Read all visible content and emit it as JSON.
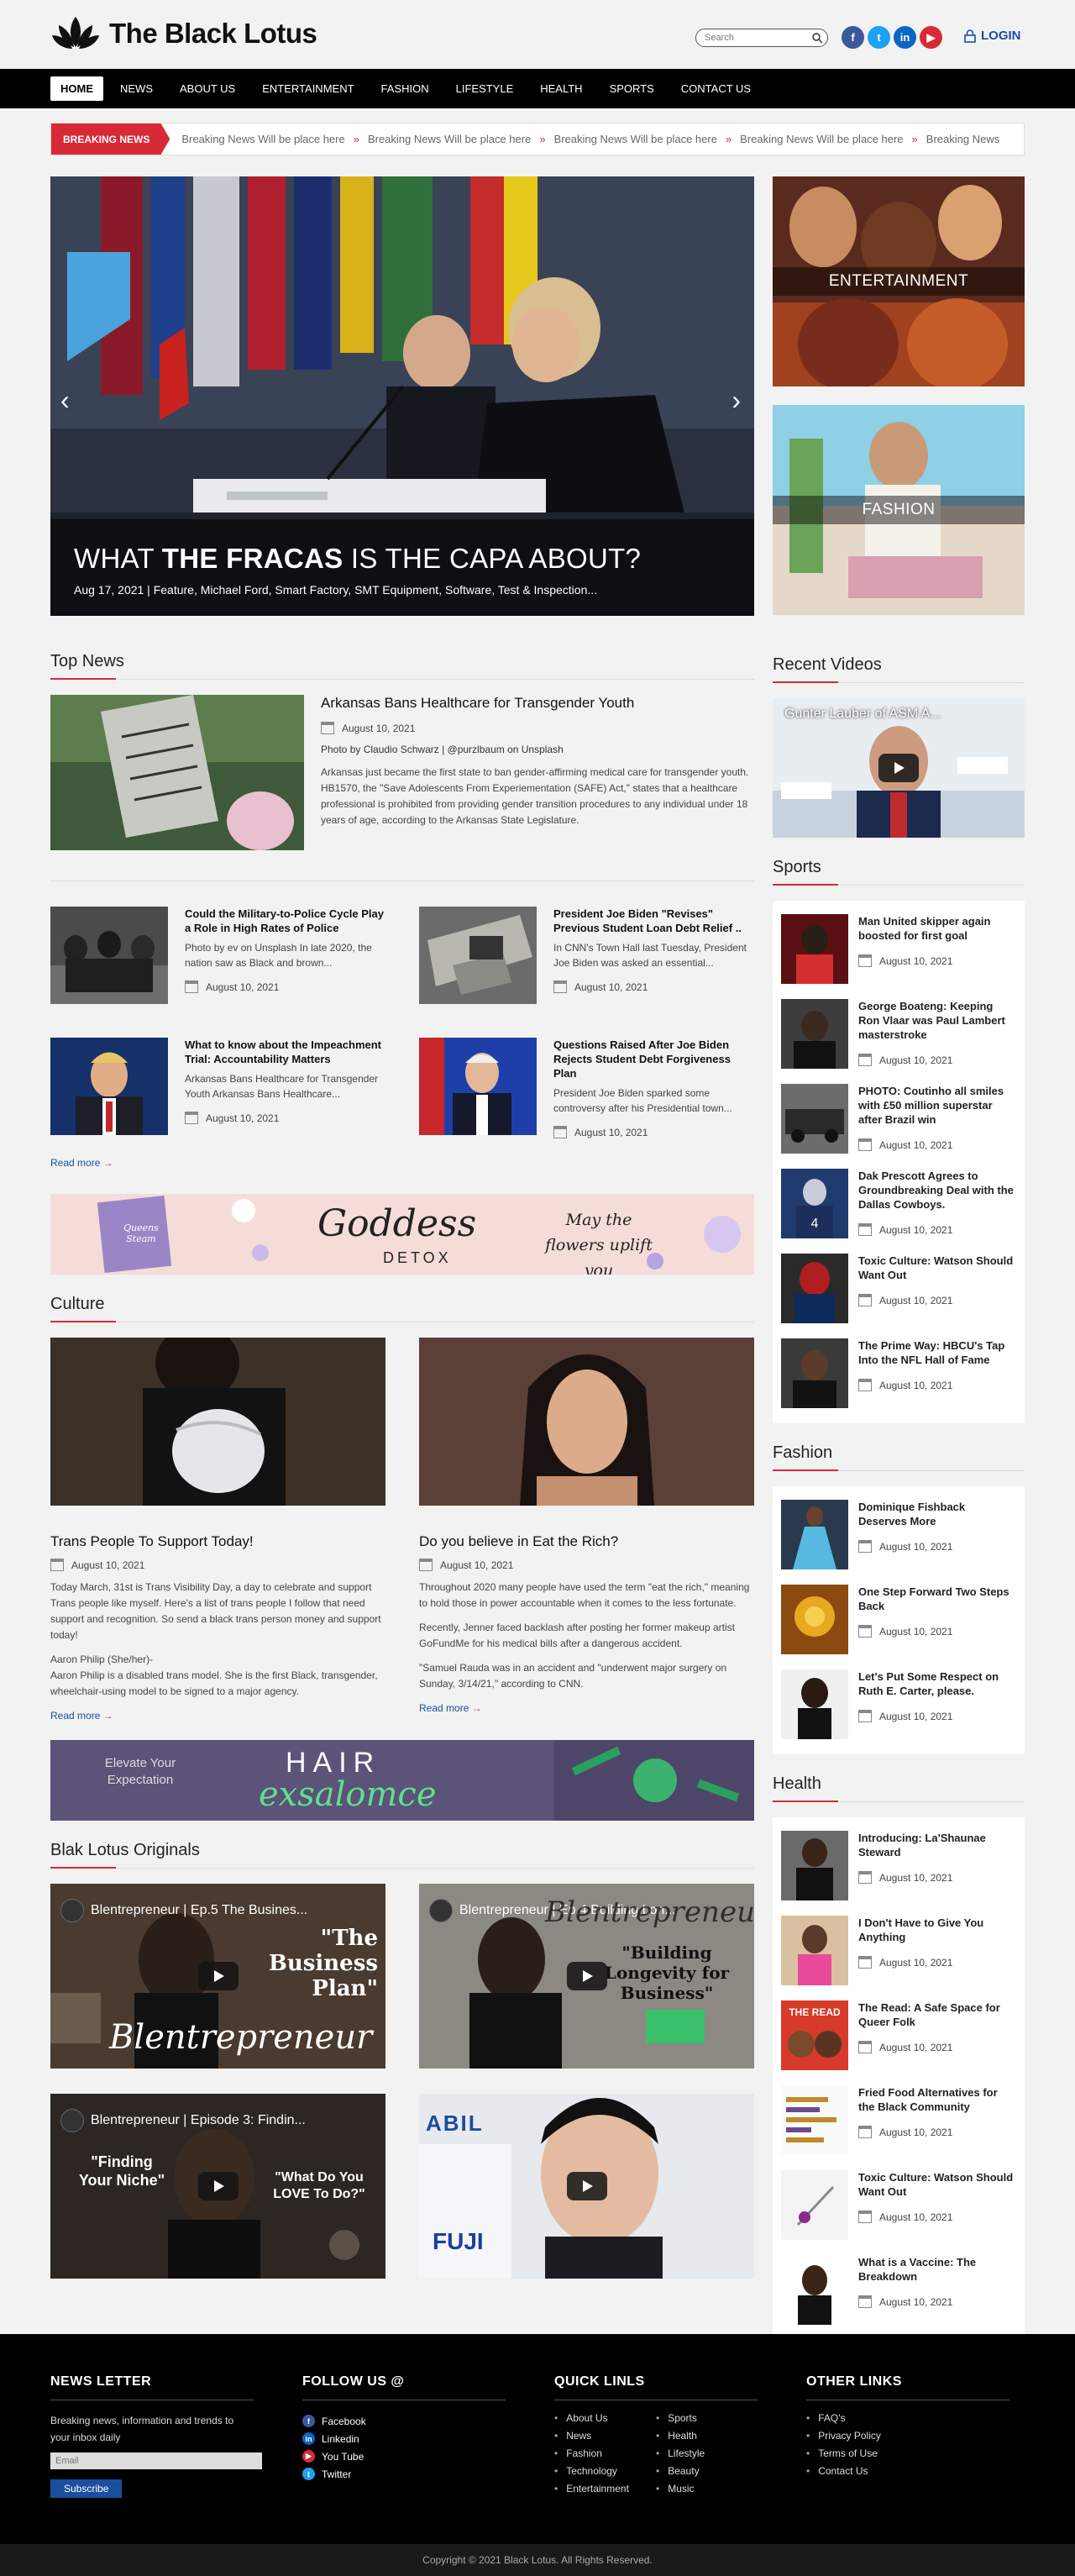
{
  "site": {
    "name": "The Black Lotus",
    "login": "LOGIN"
  },
  "search": {
    "placeholder": "Search"
  },
  "nav": [
    "HOME",
    "NEWS",
    "ABOUT US",
    "ENTERTAINMENT",
    "FASHION",
    "LIFESTYLE",
    "HEALTH",
    "SPORTS",
    "CONTACT US"
  ],
  "breaking": {
    "label": "BREAKING NEWS",
    "items": [
      "Breaking News Will be place here",
      "Breaking News Will be place here",
      "Breaking News Will be place here",
      "Breaking News Will be place here",
      "Breaking News"
    ]
  },
  "hero": {
    "title_pre": "WHAT ",
    "title_bold": "THE FRACAS",
    "title_post": " IS THE CAPA ABOUT?",
    "meta": "Aug 17, 2021 | Feature, Michael Ford, Smart Factory, SMT Equipment, Software, Test & Inspection..."
  },
  "side_cards": [
    "ENTERTAINMENT",
    "FASHION"
  ],
  "top_news": {
    "title": "Top News",
    "feature": {
      "headline": "Arkansas Bans Healthcare for Transgender Youth",
      "date": "August 10, 2021",
      "credit": "Photo by Claudio Schwarz | @purzlbaum on Unsplash",
      "body": "Arkansas just became the first state to ban gender-affirming medical care for transgender youth. HB1570, the \"Save Adolescents From Experiementation (SAFE) Act,\" states that a healthcare professional is prohibited from providing gender transition procedures to any individual under 18 years of age, according to the Arkansas State Legislature."
    },
    "items": [
      {
        "headline": "Could the Military-to-Police Cycle Play a Role in High Rates of Police",
        "excerpt": "Photo by ev on Unsplash In late 2020, the nation saw as Black and brown...",
        "date": "August 10, 2021"
      },
      {
        "headline": "President Joe Biden \"Revises\" Previous Student Loan Debt Relief ..",
        "excerpt": "In CNN's Town Hall last Tuesday, President Joe Biden was asked an essential...",
        "date": "August 10, 2021"
      },
      {
        "headline": "What to know about the Impeachment Trial: Accountability Matters",
        "excerpt": "Arkansas Bans Healthcare for Transgender Youth Arkansas Bans Healthcare...",
        "date": "August 10, 2021"
      },
      {
        "headline": "Questions Raised After Joe Biden Rejects Student Debt Forgiveness Plan",
        "excerpt": "President Joe Biden sparked some controversy after his Presidential town...",
        "date": "August 10, 2021"
      }
    ],
    "read_more": "Read more"
  },
  "banner1": {
    "left_text": "Queens Steam",
    "script": "Goddess",
    "sub": "DETOX",
    "right": "May the flowers uplift you"
  },
  "culture": {
    "title": "Culture",
    "items": [
      {
        "headline": "Trans People To Support Today!",
        "date": "August 10, 2021",
        "paras": [
          "Today March, 31st is Trans Visibility Day, a day to celebrate and support Trans people like myself. Here's a list of trans people I follow that need support and recognition. So send a black trans person money and support today!",
          "Aaron Philip (She/her)-\nAaron Philip is a disabled trans model. She is the first Black, transgender, wheelchair-using model to be signed to a major agency."
        ]
      },
      {
        "headline": "Do you believe in Eat the Rich?",
        "date": "August 10, 2021",
        "paras": [
          "Throughout 2020 many people have used the term \"eat the rich,\" meaning to hold those in power accountable when it comes to the less fortunate.",
          "Recently, Jenner faced backlash after posting her former makeup artist GoFundMe for his medical bills after a dangerous accident.",
          "\"Samuel Rauda was in an accident and \"underwent major surgery on Sunday, 3/14/21,\" according to CNN."
        ]
      }
    ],
    "read_more": "Read more"
  },
  "banner2": {
    "left": "Elevate Your Expectation",
    "title": "HAIR",
    "script": "exsalomce"
  },
  "originals": {
    "title": "Blak Lotus Originals",
    "videos": [
      {
        "title": "Blentrepreneur | Ep.5 The Busines...",
        "overlay1": "\"The Business Plan\"",
        "overlay2": "Blentrepreneur"
      },
      {
        "title": "Blentrepreneur | Ep.4 Building Lon...",
        "overlay1": "\"Building Longevity for Business\"",
        "overlay2": "Blentrepreneur"
      },
      {
        "title": "Blentrepreneur | Episode 3: Findin...",
        "overlay1": "\"Finding Your Niche\"",
        "overlay2": "\"What Do You LOVE To Do?\""
      },
      {
        "title": "",
        "overlay1": "ABIL",
        "overlay2": "FUJI"
      }
    ]
  },
  "recent_videos": {
    "title": "Recent Videos",
    "video_title": "Gunter Lauber of ASM A..."
  },
  "sports": {
    "title": "Sports",
    "items": [
      {
        "headline": "Man United skipper again boosted for first goal",
        "date": "August 10, 2021"
      },
      {
        "headline": "George Boateng: Keeping Ron Vlaar was Paul Lambert masterstroke",
        "date": "August 10, 2021"
      },
      {
        "headline": "PHOTO: Coutinho all smiles with £50 million superstar after Brazil win",
        "date": "August 10, 2021"
      },
      {
        "headline": "Dak Prescott Agrees to Groundbreaking Deal with the Dallas Cowboys.",
        "date": "August 10, 2021"
      },
      {
        "headline": "Toxic Culture: Watson Should Want Out",
        "date": "August 10, 2021"
      },
      {
        "headline": "The Prime Way: HBCU's Tap Into the NFL Hall of Fame",
        "date": "August 10, 2021"
      }
    ]
  },
  "fashion": {
    "title": "Fashion",
    "items": [
      {
        "headline": "Dominique Fishback Deserves More",
        "date": "August 10, 2021"
      },
      {
        "headline": "One Step Forward Two Steps Back",
        "date": "August 10, 2021"
      },
      {
        "headline": "Let's Put Some Respect on Ruth E. Carter, please.",
        "date": "August 10, 2021"
      }
    ]
  },
  "health": {
    "title": "Health",
    "items": [
      {
        "headline": "Introducing: La'Shaunae Steward",
        "date": "August 10, 2021"
      },
      {
        "headline": "I Don't Have to Give You Anything",
        "date": "August 10, 2021"
      },
      {
        "headline": "The Read: A Safe Space for Queer Folk",
        "date": "August 10, 2021"
      },
      {
        "headline": "Fried Food Alternatives for the Black Community",
        "date": "August 10, 2021"
      },
      {
        "headline": "Toxic Culture: Watson Should Want Out",
        "date": "August 10, 2021"
      },
      {
        "headline": "What is a Vaccine: The Breakdown",
        "date": "August 10, 2021"
      }
    ]
  },
  "footer": {
    "newsletter": {
      "title": "NEWS LETTER",
      "text": "Breaking news, information and trends to your inbox daily",
      "placeholder": "Email",
      "button": "Subscribe"
    },
    "follow": {
      "title": "FOLLOW US @",
      "items": [
        "Facebook",
        "Linkedin",
        "You Tube",
        "Twitter"
      ]
    },
    "quick": {
      "title": "QUICK LINLS",
      "items": [
        "About Us",
        "Sports",
        "News",
        "Health",
        "Fashion",
        "Lifestyle",
        "Technology",
        "Beauty",
        "Entertainment",
        "Music"
      ]
    },
    "other": {
      "title": "OTHER LINKS",
      "items": [
        "FAQ's",
        "Privacy Policy",
        "Terms of Use",
        "Contact Us"
      ]
    },
    "copyright": "Copyright © 2021 Black Lotus. All Rights Reserved."
  },
  "colors": {
    "accent": "#d72a36",
    "link": "#1a4fa0",
    "nav_bg": "#000000",
    "page_bg": "#f2f2f2"
  }
}
